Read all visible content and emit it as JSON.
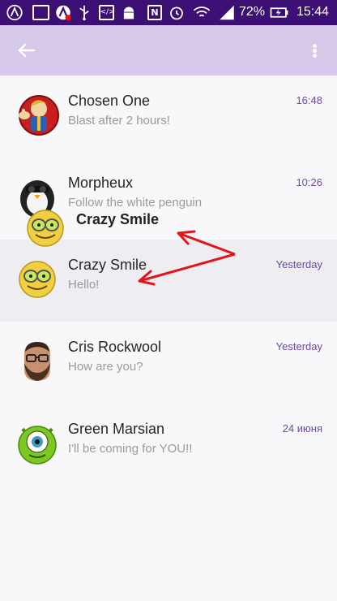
{
  "status_bar": {
    "battery": "72%",
    "time": "15:44",
    "icons": [
      "app-logo-icon",
      "image-icon",
      "avast-icon",
      "usb-icon",
      "code-icon",
      "android-icon",
      "nfc-icon",
      "alarm-icon",
      "wifi-icon",
      "signal-icon",
      "battery-charging-icon"
    ]
  },
  "appbar": {
    "back_icon": "arrow-left-icon",
    "menu_icon": "more-vert-icon"
  },
  "chats": [
    {
      "name": "Chosen One",
      "message": "Blast after 2 hours!",
      "time": "16:48",
      "avatar": "vault-boy-avatar"
    },
    {
      "name": "Morpheux",
      "message": "Follow the white penguin",
      "time": "10:26",
      "avatar": "penguin-avatar"
    },
    {
      "name": "Crazy Smile",
      "message": "Hello!",
      "time": "Yesterday",
      "avatar": "crazy-smiley-avatar"
    },
    {
      "name": "Cris Rockwool",
      "message": "How are you?",
      "time": "Yesterday",
      "avatar": "bearded-man-avatar"
    },
    {
      "name": "Green Marsian",
      "message": "I'll be coming for YOU!!",
      "time": "24 июня",
      "avatar": "green-monster-avatar"
    }
  ],
  "drag": {
    "name": "Crazy Smile",
    "avatar": "crazy-smiley-avatar"
  },
  "colors": {
    "status_bar": "#3b0f73",
    "appbar": "#d6c8e8",
    "time_accent": "#6b4aa0",
    "annotation_arrow": "#e5141b"
  }
}
